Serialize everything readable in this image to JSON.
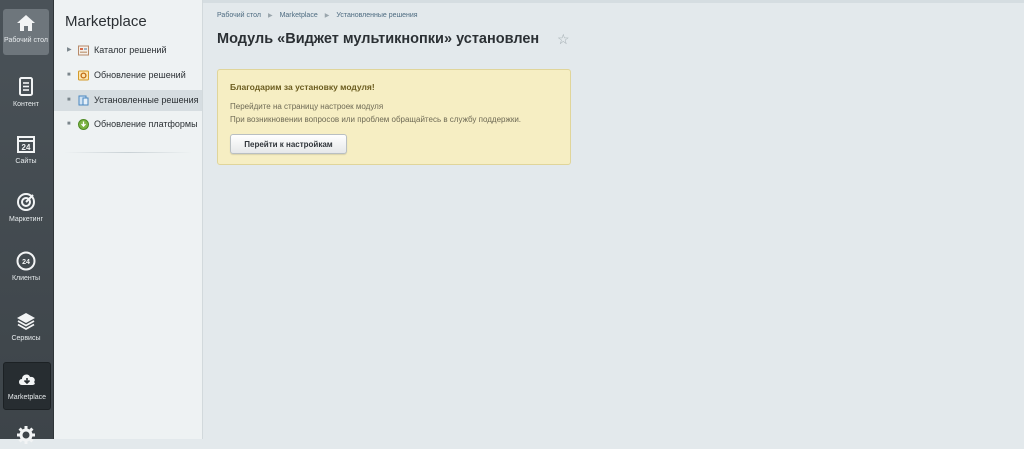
{
  "rail": {
    "items": [
      {
        "label": "Рабочий стол",
        "icon": "home-icon"
      },
      {
        "label": "Контент",
        "icon": "document-icon"
      },
      {
        "label": "Сайты",
        "icon": "calendar-24-icon"
      },
      {
        "label": "Маркетинг",
        "icon": "target-icon"
      },
      {
        "label": "Клиенты",
        "icon": "clients-24-icon"
      },
      {
        "label": "Сервисы",
        "icon": "layers-icon"
      },
      {
        "label": "Marketplace",
        "icon": "cloud-download-icon"
      },
      {
        "label": "",
        "icon": "gear-icon"
      }
    ]
  },
  "submenu": {
    "title": "Marketplace",
    "items": [
      {
        "label": "Каталог решений",
        "icon": "catalog-icon"
      },
      {
        "label": "Обновление решений",
        "icon": "update-solutions-icon"
      },
      {
        "label": "Установленные решения",
        "icon": "installed-solutions-icon"
      },
      {
        "label": "Обновление платформы",
        "icon": "platform-update-icon"
      }
    ]
  },
  "breadcrumb": [
    "Рабочий стол",
    "Marketplace",
    "Установленные решения"
  ],
  "page": {
    "title": "Модуль «Виджет мультикнопки» установлен"
  },
  "notice": {
    "title": "Благодарим за установку модуля!",
    "line1": "Перейдите на страницу настроек модуля",
    "line2": "При возникновении вопросов или проблем обращайтесь в службу поддержки.",
    "button": "Перейти к настройкам"
  },
  "colors": {
    "rail_bg": "#434a4f",
    "notice_bg": "#f6eec3",
    "notice_border": "#e0d59a",
    "page_bg": "#e3e9ec"
  }
}
